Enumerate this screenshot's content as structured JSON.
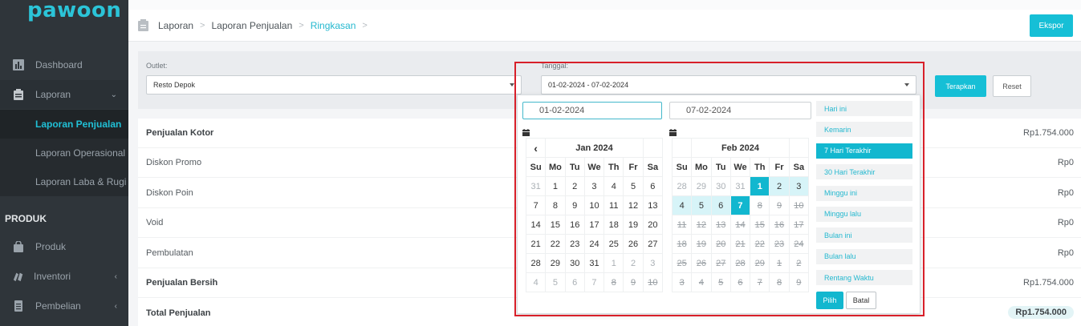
{
  "app": {
    "logo": "pawoon"
  },
  "sidebar": {
    "items": [
      {
        "label": "Dashboard",
        "icon": "chart-icon"
      },
      {
        "label": "Laporan",
        "icon": "clipboard-icon",
        "chevron": "⌄"
      },
      {
        "label": "Produk",
        "icon": "bag-icon"
      },
      {
        "label": "Inventori",
        "icon": "boxes-icon",
        "chevron": "‹"
      },
      {
        "label": "Pembelian",
        "icon": "document-icon",
        "chevron": "‹"
      }
    ],
    "sub_items": [
      "Laporan Penjualan",
      "Laporan Operasional",
      "Laporan Laba & Rugi"
    ],
    "section_head": "PRODUK"
  },
  "breadcrumb": {
    "items": [
      "Laporan",
      "Laporan Penjualan",
      "Ringkasan"
    ]
  },
  "header": {
    "export_label": "Ekspor"
  },
  "filters": {
    "outlet_label": "Outlet:",
    "outlet_value": "Resto Depok",
    "date_label": "Tanggal:",
    "date_value": "01-02-2024 - 07-02-2024",
    "apply_label": "Terapkan",
    "reset_label": "Reset"
  },
  "summary": {
    "rows": [
      {
        "label": "Penjualan Kotor",
        "value": "Rp1.754.000",
        "bold": true
      },
      {
        "label": "Diskon Promo",
        "value": "Rp0"
      },
      {
        "label": "Diskon Poin",
        "value": "Rp0"
      },
      {
        "label": "Void",
        "value": "Rp0"
      },
      {
        "label": "Pembulatan",
        "value": "Rp0"
      },
      {
        "label": "Penjualan Bersih",
        "value": "Rp1.754.000",
        "bold": true
      },
      {
        "label": "Total Penjualan",
        "value": "Rp1.754.000",
        "bold": true,
        "pill": true
      }
    ]
  },
  "datepicker": {
    "start_input": "01-02-2024",
    "end_input": "07-02-2024",
    "weekdays": [
      "Su",
      "Mo",
      "Tu",
      "We",
      "Th",
      "Fr",
      "Sa"
    ],
    "left": {
      "month": "Jan 2024",
      "prev": "‹",
      "weeks": [
        [
          "31",
          "1",
          "2",
          "3",
          "4",
          "5",
          "6"
        ],
        [
          "7",
          "8",
          "9",
          "10",
          "11",
          "12",
          "13"
        ],
        [
          "14",
          "15",
          "16",
          "17",
          "18",
          "19",
          "20"
        ],
        [
          "21",
          "22",
          "23",
          "24",
          "25",
          "26",
          "27"
        ],
        [
          "28",
          "29",
          "30",
          "31",
          "1",
          "2",
          "3"
        ],
        [
          "4",
          "5",
          "6",
          "7",
          "8",
          "9",
          "10"
        ]
      ]
    },
    "right": {
      "month": "Feb 2024",
      "weeks": [
        [
          "28",
          "29",
          "30",
          "31",
          "1",
          "2",
          "3"
        ],
        [
          "4",
          "5",
          "6",
          "7",
          "8",
          "9",
          "10"
        ],
        [
          "11",
          "12",
          "13",
          "14",
          "15",
          "16",
          "17"
        ],
        [
          "18",
          "19",
          "20",
          "21",
          "22",
          "23",
          "24"
        ],
        [
          "25",
          "26",
          "27",
          "28",
          "29",
          "1",
          "2"
        ],
        [
          "3",
          "4",
          "5",
          "6",
          "7",
          "8",
          "9"
        ]
      ]
    },
    "ranges": [
      "Hari ini",
      "Kemarin",
      "7 Hari Terakhir",
      "30 Hari Terakhir",
      "Minggu ini",
      "Minggu lalu",
      "Bulan ini",
      "Bulan lalu",
      "Rentang Waktu"
    ],
    "active_range": "7 Hari Terakhir",
    "apply_label": "Pilih",
    "cancel_label": "Batal"
  },
  "colors": {
    "accent": "#16bfd6",
    "sidebar": "#2f353a",
    "highlight_border": "#d8202a"
  }
}
